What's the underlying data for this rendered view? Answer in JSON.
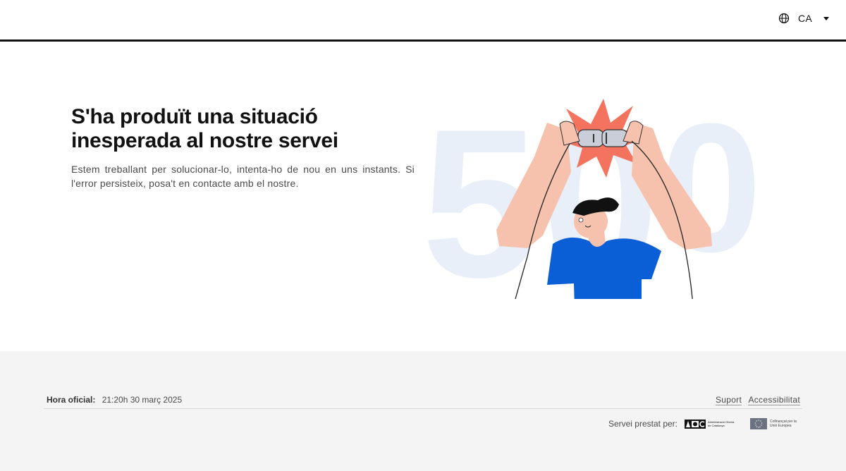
{
  "header": {
    "language_code": "CA"
  },
  "error": {
    "title_line1": "S'ha produït una situació",
    "title_line2": "inesperada al nostre servei",
    "description": "Estem treballant per solucionar-lo, intenta-ho de nou en uns instants. Si l'error persisteix, posa't en contacte amb el nostre.",
    "code_digits": [
      "5",
      "0",
      "0"
    ]
  },
  "footer": {
    "official_time_label": "Hora oficial:",
    "official_time_value": "21:20h 30 març 2025",
    "links": {
      "support": "Suport",
      "accessibility": "Accessibilitat"
    },
    "served_by_label": "Servei prestat per:",
    "aoc_text": "Administració Oberta de Catalunya",
    "eu_text": "Cofinançat per la Unió Europea"
  },
  "colors": {
    "accent_blue": "#0a5fd6",
    "burst": "#f4735f",
    "skin": "#f6c1ad",
    "digits": "#e9eff8",
    "footer_bg": "#f4f4f4"
  }
}
